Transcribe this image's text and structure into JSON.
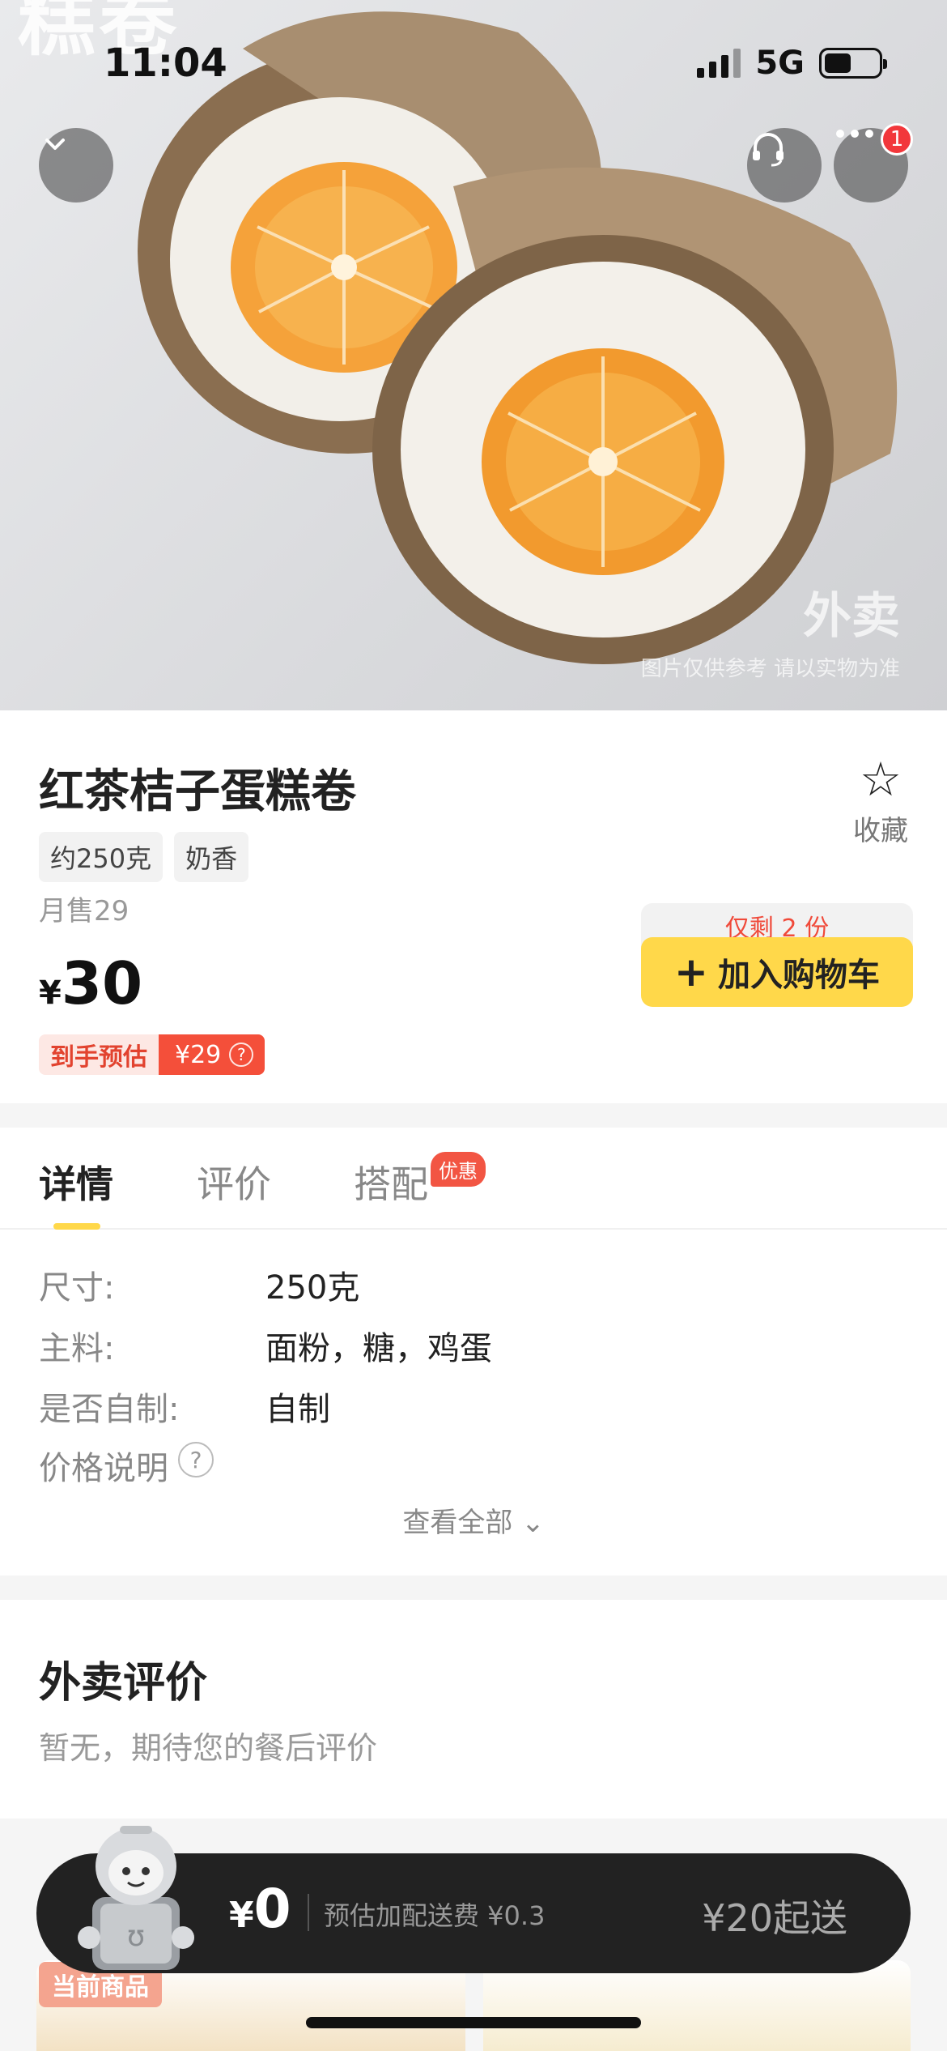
{
  "status_bar": {
    "time": "11:04",
    "network": "5G"
  },
  "hero": {
    "watermark_top": "糕卷",
    "watermark_brand": "外卖",
    "watermark_note": "图片仅供参考 请以实物为准",
    "more_badge": "1"
  },
  "product": {
    "title": "红茶桔子蛋糕卷",
    "favorite_label": "收藏",
    "tags": [
      "约250克",
      "奶香"
    ],
    "monthly_sales": "月售29",
    "price_symbol": "¥",
    "price": "30",
    "estimate_label": "到手预估",
    "estimate_price": "¥29",
    "stock_note": "仅剩 2 份",
    "add_to_cart": "加入购物车"
  },
  "tabs": [
    {
      "label": "详情"
    },
    {
      "label": "评价"
    },
    {
      "label": "搭配",
      "badge": "优惠"
    }
  ],
  "specs": [
    {
      "key": "尺寸:",
      "value": "250克"
    },
    {
      "key": "主料:",
      "value": "面粉，糖，鸡蛋"
    },
    {
      "key": "是否自制:",
      "value": "自制"
    }
  ],
  "price_note": "价格说明",
  "see_all": "查看全部",
  "reviews": {
    "heading": "外卖评价",
    "empty": "暂无，期待您的餐后评价"
  },
  "cart_bar": {
    "currency": "¥",
    "total": "0",
    "delivery_fee": "预估加配送费 ¥0.3",
    "min_order": "¥20起送"
  },
  "current_item_tag": "当前商品",
  "colors": {
    "accent_yellow": "#ffd84a",
    "price_red": "#f44f3a",
    "cart_bar": "#222222"
  }
}
